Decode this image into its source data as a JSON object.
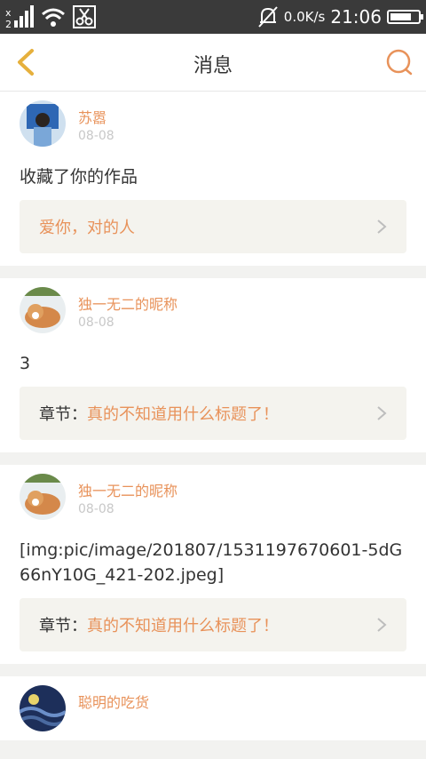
{
  "status_bar": {
    "net_speed": "0.0K/s",
    "time": "21:06",
    "battery_level": 0.75
  },
  "header": {
    "title": "消息"
  },
  "messages": [
    {
      "username": "苏嚣",
      "date": "08-08",
      "text": "收藏了你的作品",
      "ref_prefix": "",
      "ref_title": "爱你，对的人"
    },
    {
      "username": "独一无二的昵称",
      "date": "08-08",
      "text": "3",
      "ref_prefix": "章节：",
      "ref_title": "真的不知道用什么标题了！"
    },
    {
      "username": "独一无二的昵称",
      "date": "08-08",
      "text": "[img:pic/image/201807/1531197670601-5dG66nY10G_421-202.jpeg]",
      "ref_prefix": "章节：",
      "ref_title": "真的不知道用什么标题了！"
    },
    {
      "username": "聪明的吃货",
      "date": "",
      "text": "",
      "ref_prefix": "",
      "ref_title": ""
    }
  ],
  "colors": {
    "accent": "#e8925a",
    "status_bar_bg": "#3a3a3a",
    "ref_bg": "#f4f3ee"
  },
  "icons": {
    "back": "chevron-left-icon",
    "search": "search-icon",
    "ref_arrow": "chevron-right-icon"
  }
}
